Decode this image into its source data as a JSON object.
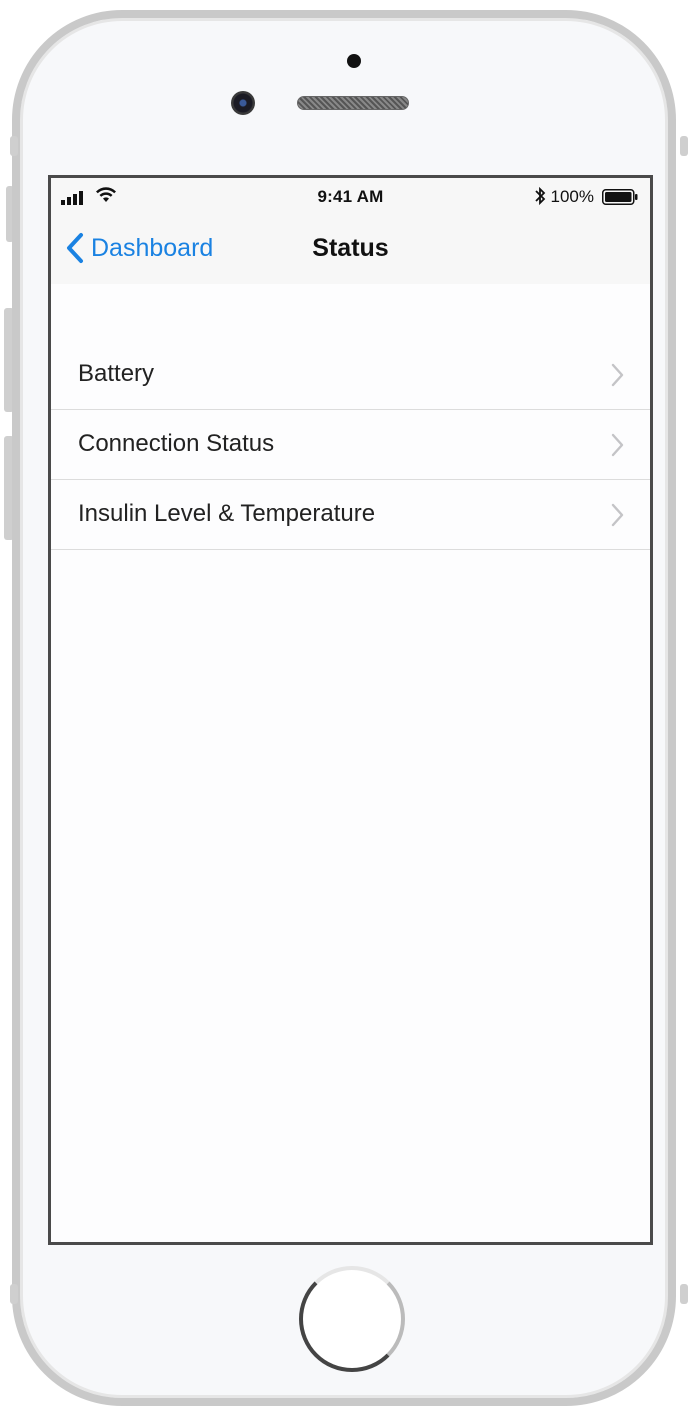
{
  "status_bar": {
    "time": "9:41 AM",
    "battery_percent": "100%",
    "icons": [
      "signal-icon",
      "wifi-icon",
      "bluetooth-icon",
      "battery-icon"
    ]
  },
  "nav": {
    "back_label": "Dashboard",
    "title": "Status"
  },
  "list": {
    "items": [
      {
        "label": "Battery"
      },
      {
        "label": "Connection Status"
      },
      {
        "label": "Insulin Level & Temperature"
      }
    ]
  },
  "colors": {
    "accent": "#1a82e2",
    "text": "#222222",
    "separator": "#dcdcdc",
    "bar_background": "#f7f7f7"
  }
}
